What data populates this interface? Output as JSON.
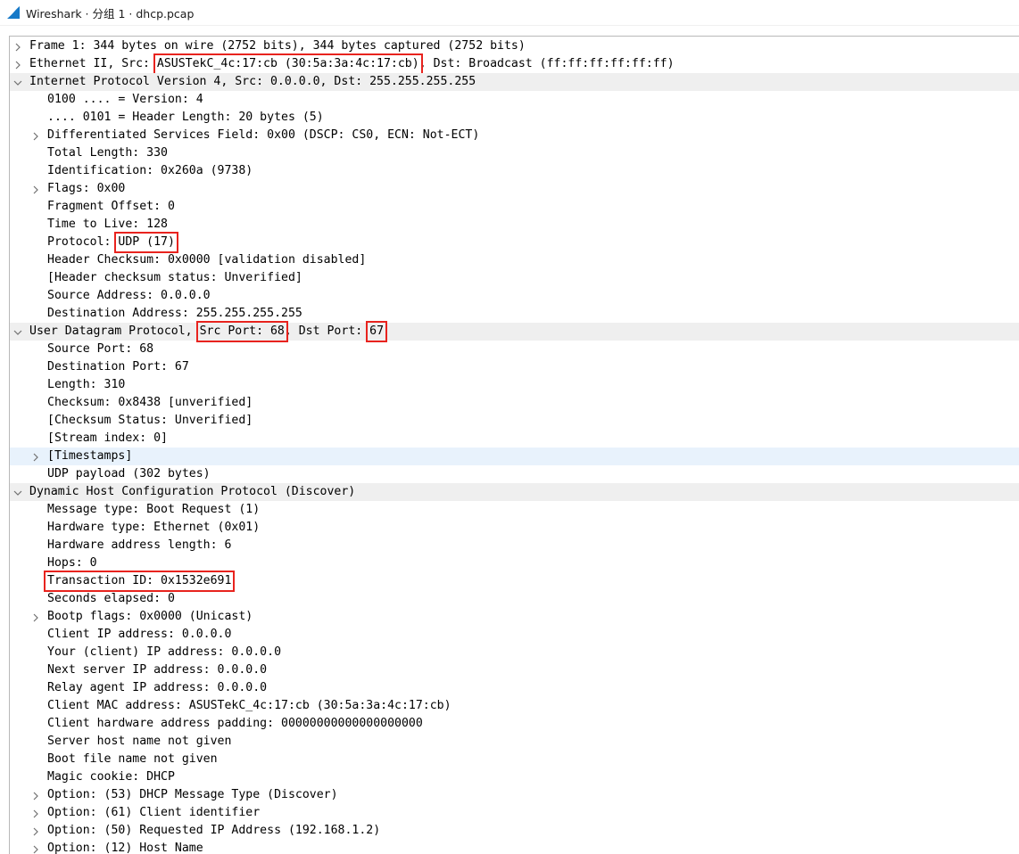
{
  "window": {
    "title": "Wireshark · 分组 1 · dhcp.pcap",
    "icon": "wireshark-fin-icon"
  },
  "tree": {
    "frame": "Frame 1: 344 bytes on wire (2752 bits), 344 bytes captured (2752 bits)",
    "ethernet_prefix": "Ethernet II, Src: ",
    "ethernet_src": "ASUSTekC_4c:17:cb (30:5a:3a:4c:17:cb)",
    "ethernet_suffix": ", Dst: Broadcast (ff:ff:ff:ff:ff:ff)",
    "ip_header": "Internet Protocol Version 4, Src: 0.0.0.0, Dst: 255.255.255.255",
    "ip_version": "0100 .... = Version: 4",
    "ip_header_length": ".... 0101 = Header Length: 20 bytes (5)",
    "ip_dsfield": "Differentiated Services Field: 0x00 (DSCP: CS0, ECN: Not-ECT)",
    "ip_total_length": "Total Length: 330",
    "ip_identification": "Identification: 0x260a (9738)",
    "ip_flags": "Flags: 0x00",
    "ip_fragment_offset": "Fragment Offset: 0",
    "ip_ttl": "Time to Live: 128",
    "ip_protocol_prefix": "Protocol: ",
    "ip_protocol_value": "UDP (17)",
    "ip_checksum": "Header Checksum: 0x0000 [validation disabled]",
    "ip_checksum_status": "[Header checksum status: Unverified]",
    "ip_src": "Source Address: 0.0.0.0",
    "ip_dst": "Destination Address: 255.255.255.255",
    "udp_prefix": "User Datagram Protocol,",
    "udp_src_port": "Src Port: 68",
    "udp_middle": ", Dst Port: ",
    "udp_dst_port": "67",
    "udp_source_port": "Source Port: 68",
    "udp_destination_port": "Destination Port: 67",
    "udp_length": "Length: 310",
    "udp_checksum": "Checksum: 0x8438 [unverified]",
    "udp_checksum_status": "[Checksum Status: Unverified]",
    "udp_stream_index": "[Stream index: 0]",
    "udp_timestamps": "[Timestamps]",
    "udp_payload": "UDP payload (302 bytes)",
    "dhcp_header": "Dynamic Host Configuration Protocol (Discover)",
    "dhcp_message_type": "Message type: Boot Request (1)",
    "dhcp_hw_type": "Hardware type: Ethernet (0x01)",
    "dhcp_hw_len": "Hardware address length: 6",
    "dhcp_hops": "Hops: 0",
    "dhcp_transaction_id": "Transaction ID: 0x1532e691",
    "dhcp_seconds": "Seconds elapsed: 0",
    "dhcp_bootp_flags": "Bootp flags: 0x0000 (Unicast)",
    "dhcp_client_ip": "Client IP address: 0.0.0.0",
    "dhcp_your_ip": "Your (client) IP address: 0.0.0.0",
    "dhcp_next_server": "Next server IP address: 0.0.0.0",
    "dhcp_relay_agent": "Relay agent IP address: 0.0.0.0",
    "dhcp_client_mac": "Client MAC address: ASUSTekC_4c:17:cb (30:5a:3a:4c:17:cb)",
    "dhcp_hw_padding": "Client hardware address padding: 00000000000000000000",
    "dhcp_server_host": "Server host name not given",
    "dhcp_boot_file": "Boot file name not given",
    "dhcp_magic_cookie": "Magic cookie: DHCP",
    "dhcp_option_53": "Option: (53) DHCP Message Type (Discover)",
    "dhcp_option_61": "Option: (61) Client identifier",
    "dhcp_option_50": "Option: (50) Requested IP Address (192.168.1.2)",
    "dhcp_option_12": "Option: (12) Host Name"
  },
  "colors": {
    "highlight_box": "#e8231e",
    "section_header_bg": "#efefef",
    "selected_row_bg": "#e8f2fc",
    "wireshark_blue": "#1679c8"
  }
}
